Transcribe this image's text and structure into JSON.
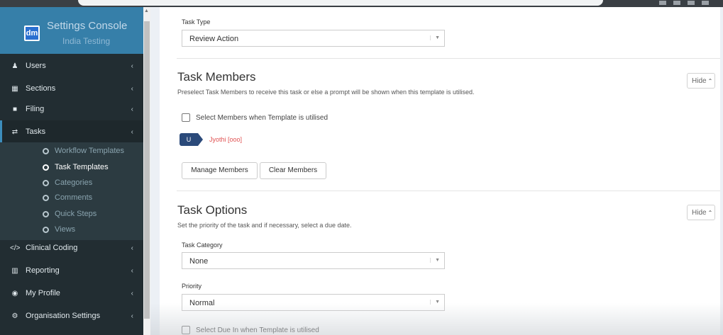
{
  "sidebar": {
    "logo_text": "dm",
    "brand_title": "Settings Console",
    "brand_subtitle": "India Testing",
    "items": [
      {
        "label": "Users",
        "icon": "user-icon",
        "glyph": "♟"
      },
      {
        "label": "Sections",
        "icon": "table-icon",
        "glyph": "▦"
      },
      {
        "label": "Filing",
        "icon": "folder-icon",
        "glyph": "■"
      },
      {
        "label": "Tasks",
        "icon": "exchange-icon",
        "glyph": "⇄"
      },
      {
        "label": "Clinical Coding",
        "icon": "code-icon",
        "glyph": "</>"
      },
      {
        "label": "Reporting",
        "icon": "bar-chart-icon",
        "glyph": "▥"
      },
      {
        "label": "My Profile",
        "icon": "profile-icon",
        "glyph": "◉"
      },
      {
        "label": "Organisation Settings",
        "icon": "cogs-icon",
        "glyph": "⚙"
      }
    ],
    "chevron": "‹",
    "tasks_sub": [
      {
        "label": "Workflow Templates"
      },
      {
        "label": "Task Templates",
        "current": true
      },
      {
        "label": "Categories"
      },
      {
        "label": "Comments"
      },
      {
        "label": "Quick Steps"
      },
      {
        "label": "Views"
      }
    ]
  },
  "main": {
    "task_type": {
      "label": "Task Type",
      "value": "Review Action"
    },
    "members": {
      "title": "Task Members",
      "description": "Preselect Task Members to receive this task or else a prompt will be shown when this template is utilised.",
      "hide_label": "Hide",
      "checkbox_label": "Select Members when Template is utilised",
      "member_badge": "U",
      "member_name": "Jyothi [ooo]",
      "manage_button": "Manage Members",
      "clear_button": "Clear Members"
    },
    "options": {
      "title": "Task Options",
      "description": "Set the priority of the task and if necessary, select a due date.",
      "hide_label": "Hide",
      "category_label": "Task Category",
      "category_value": "None",
      "priority_label": "Priority",
      "priority_value": "Normal",
      "due_checkbox_label": "Select Due In when Template is utilised"
    }
  }
}
